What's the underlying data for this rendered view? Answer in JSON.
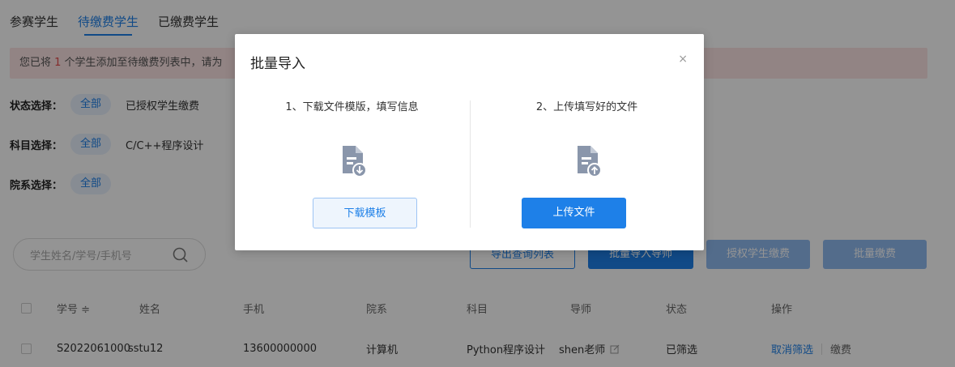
{
  "tabs": [
    {
      "label": "参赛学生"
    },
    {
      "label": "待缴费学生"
    },
    {
      "label": "已缴费学生"
    }
  ],
  "alert": {
    "prefix": "您已将 ",
    "count": "1",
    "suffix": " 个学生添加至待缴费列表中，请为"
  },
  "filters": {
    "status": {
      "label": "状态选择：",
      "selected": "全部",
      "option": "已授权学生缴费"
    },
    "subject": {
      "label": "科目选择：",
      "selected": "全部",
      "option": "C/C++程序设计"
    },
    "department": {
      "label": "院系选择：",
      "selected": "全部"
    }
  },
  "search": {
    "placeholder": "学生姓名/学号/手机号"
  },
  "toolbar": {
    "export_label": "导出查询列表",
    "import_mentor_label": "批量导入导师",
    "auth_pay_label": "授权学生缴费",
    "batch_pay_label": "批量缴费"
  },
  "table": {
    "headers": {
      "id": "学号 ≑",
      "name": "姓名",
      "phone": "手机",
      "dept": "院系",
      "subject": "科目",
      "mentor": "导师",
      "status": "状态",
      "action": "操作"
    },
    "rows": [
      {
        "id": "S2022061000",
        "name": "sstu12",
        "phone": "13600000000",
        "dept": "计算机",
        "subject": "Python程序设计",
        "mentor": "shen老师",
        "status": "已筛选",
        "cancel": "取消筛选",
        "pay": "缴费"
      }
    ]
  },
  "modal": {
    "title": "批量导入",
    "close": "×",
    "step1": "1、下载文件模版，填写信息",
    "step2": "2、上传填写好的文件",
    "download_label": "下载模板",
    "upload_label": "上传文件"
  },
  "colors": {
    "accent": "#1e80e8",
    "alert_bg": "#fbe3e3"
  }
}
